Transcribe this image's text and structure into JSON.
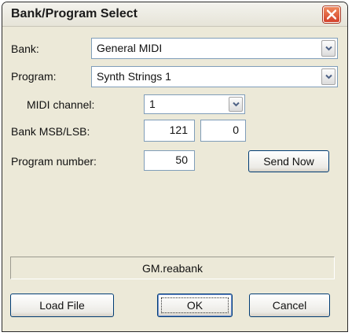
{
  "window": {
    "title": "Bank/Program Select"
  },
  "bank": {
    "label": "Bank:",
    "value": "General MIDI"
  },
  "program": {
    "label": "Program:",
    "value": "Synth Strings 1"
  },
  "midi_channel": {
    "label": "MIDI channel:",
    "value": "1"
  },
  "bank_msb_lsb": {
    "label": "Bank MSB/LSB:",
    "msb": "121",
    "lsb": "0"
  },
  "program_number": {
    "label": "Program number:",
    "value": "50"
  },
  "buttons": {
    "send_now": "Send Now",
    "load_file": "Load File",
    "ok": "OK",
    "cancel": "Cancel"
  },
  "status": {
    "file": "GM.reabank"
  },
  "icons": {
    "close": "close-icon",
    "dropdown": "chevron-down-icon"
  },
  "colors": {
    "dialog_bg": "#ece9d8",
    "close_button": "#d3412b",
    "field_border": "#7f9db9"
  }
}
